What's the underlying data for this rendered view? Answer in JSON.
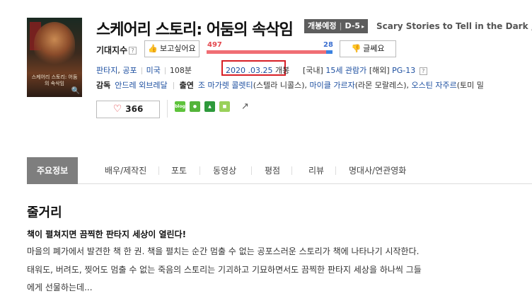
{
  "poster": {
    "title_text": "스케어리 스토리: 어둠의 속삭임",
    "icon": "magnifier-icon"
  },
  "movie": {
    "title": "스케어리 스토리: 어둠의 속삭임",
    "badge_status": "개봉예정",
    "badge_dday": "D-5",
    "english_title": "Scary Stories to Tell in the Dark ,"
  },
  "expect": {
    "label": "기대지수",
    "like_label": "보고싶어요",
    "dislike_label": "글쎄요",
    "like_count": "497",
    "dislike_count": "28",
    "like_ratio": 0.947
  },
  "info": {
    "genre1": "판타지",
    "genre_sep": ",",
    "genre2": "공포",
    "country": "미국",
    "runtime": "108분",
    "release_date": "2020 .03.25",
    "release_suffix": "개봉",
    "rating_domestic_label": "[국내]",
    "rating_domestic": "15세 관람가",
    "rating_foreign_label": "[해외]",
    "rating_foreign": "PG-13"
  },
  "credits": {
    "director_label": "감독",
    "director": "안드레 외브레달",
    "cast_label": "출연",
    "cast1": "조 마가렛 콜렛티",
    "cast1_role": "(스텔라 니콜스),",
    "cast2": "마이클 가르자",
    "cast2_role": "(라몬 모랄레스),",
    "cast3": "오스틴 자주르",
    "cast3_role": "(토미 밀"
  },
  "social": {
    "heart_count": "366",
    "icons": [
      "blog-icon",
      "cafe-icon",
      "bookmark-icon",
      "band-icon",
      "share-icon"
    ],
    "blog_label": "blog"
  },
  "tabs": [
    "주요정보",
    "배우/제작진",
    "포토",
    "동영상",
    "평점",
    "리뷰",
    "명대사/연관영화"
  ],
  "synopsis": {
    "section_title": "줄거리",
    "headline": "책이 펼쳐지면 끔찍한 판타지 세상이 열린다!",
    "line1": "마을의 폐가에서 발견한 책 한 권. 책을 펼치는 순간 멈출 수 없는 공포스러운 스토리가 책에 나타나기 시작한다.",
    "line2": " 태워도, 버려도, 찢어도 멈출 수 없는 죽음의 스토리는 기괴하고 기묘하면서도 끔찍한 판타지 세상을 하나씩 그들",
    "line3": "에게 선물하는데..."
  },
  "colors": {
    "like": "#e3484e",
    "dislike": "#3b6fd0",
    "highlight_box": "#d81f26",
    "tab_active": "#7e7e7e"
  }
}
